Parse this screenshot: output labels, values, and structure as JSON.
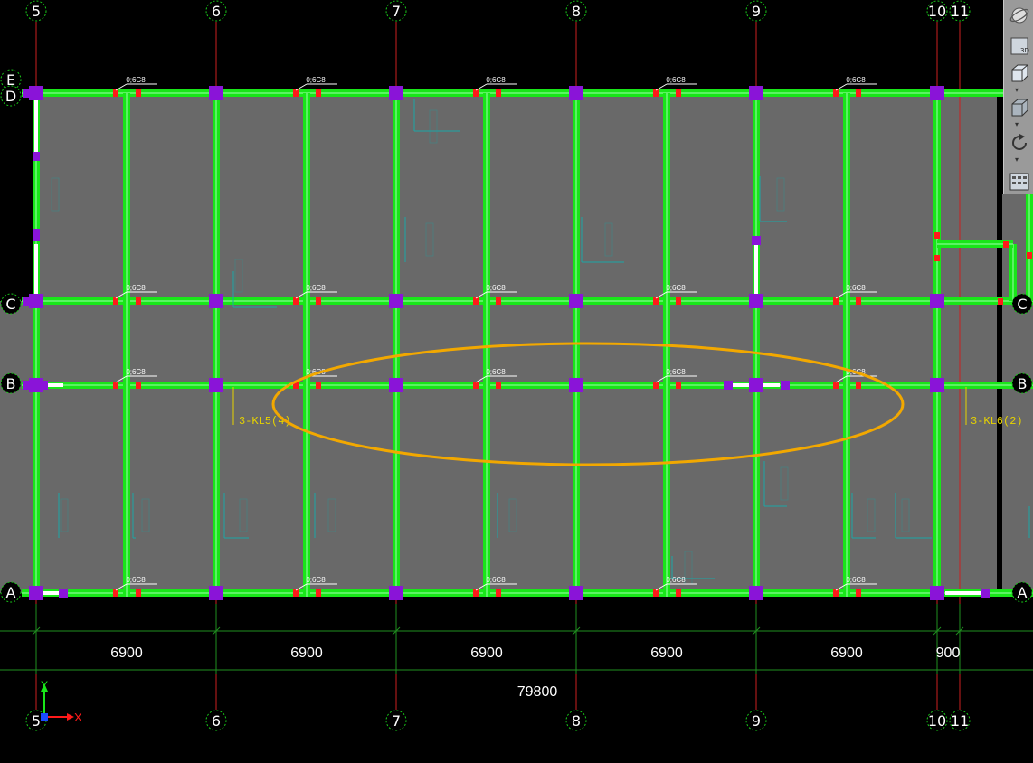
{
  "colors": {
    "background": "#000000",
    "slab": "#696969",
    "beam": "#19e619",
    "beam_core": "#9fffb0",
    "column": "#8a14d8",
    "grid_axis": "#cc1f1f",
    "dim_line": "#1f8f1f",
    "annotation": "#1aa6a6",
    "highlight_label": "#e6d200",
    "ellipse": "#f2a800",
    "rebar_mark": "#ff1a1a",
    "dim_text": "#ffffff",
    "bubble_text": "#ffffff",
    "bubble_border": "#19c819"
  },
  "axes": {
    "vertical_labels": [
      "5",
      "6",
      "7",
      "8",
      "9",
      "10",
      "11"
    ],
    "horizontal_labels": [
      "E",
      "D",
      "C",
      "B",
      "A"
    ]
  },
  "dimensions": {
    "spans": [
      "6900",
      "6900",
      "6900",
      "6900",
      "6900",
      "900"
    ],
    "total": "79800"
  },
  "beam_labels": {
    "kl5": "3-KL5(4)",
    "kl6": "3-KL6(2)",
    "rebar_tag": "0;6C8"
  },
  "ucs": {
    "x_label": "X",
    "y_label": "Y"
  },
  "toolbar": {
    "items": [
      "orbit-icon",
      "3d-view-icon",
      "box-view-icon",
      "box-view-2-icon",
      "rotate-icon",
      "panel-icon"
    ],
    "label_3d": "3D"
  }
}
